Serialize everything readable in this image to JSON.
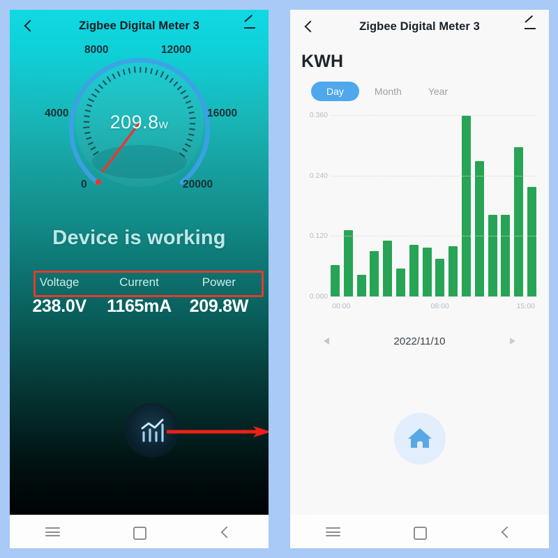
{
  "frame": {
    "background_color": "#a9c9f7"
  },
  "left_screen": {
    "header": {
      "back_icon": "back-chevron-icon",
      "title": "Zigbee Digital Meter 3",
      "edit_icon": "pencil-icon"
    },
    "gauge": {
      "value": "209.8",
      "unit": "W",
      "min": 0,
      "max": 20000,
      "ticks": [
        "0",
        "4000",
        "8000",
        "12000",
        "16000",
        "20000"
      ],
      "arc_color": "#3f9fe6",
      "needle_color": "#e8392c",
      "current_value": 209.8
    },
    "status_text": "Device is working",
    "metrics": {
      "headers": [
        "Voltage",
        "Current",
        "Power"
      ],
      "values": [
        "238.0V",
        "1165mA",
        "209.8W"
      ],
      "highlight_box_color": "#e8392c"
    },
    "chart_fab": {
      "icon": "bar-chart-icon"
    },
    "annotation_arrow": {
      "color": "#ee1f18",
      "direction": "right"
    },
    "navbar": {
      "items": [
        "recents-icon",
        "home-square-icon",
        "back-chevron-icon"
      ]
    }
  },
  "right_screen": {
    "header": {
      "back_icon": "back-chevron-icon",
      "title": "Zigbee Digital Meter 3",
      "edit_icon": "pencil-icon"
    },
    "page_title": "KWH",
    "tabs": [
      {
        "label": "Day",
        "active": true
      },
      {
        "label": "Month",
        "active": false
      },
      {
        "label": "Year",
        "active": false
      }
    ],
    "active_tab_color": "#4fa8ec",
    "date_nav": {
      "prev_icon": "triangle-left-icon",
      "date": "2022/11/10",
      "next_icon": "triangle-right-icon"
    },
    "home_button": {
      "icon": "home-icon",
      "color": "#5aa7e6",
      "background": "#e2eefc"
    },
    "navbar": {
      "items": [
        "recents-icon",
        "home-square-icon",
        "back-chevron-icon"
      ]
    }
  },
  "chart_data": {
    "type": "bar",
    "title": "KWH",
    "xlabel": "",
    "ylabel": "",
    "ylim": [
      0.0,
      0.36
    ],
    "yticks": [
      0.0,
      0.12,
      0.24,
      0.36
    ],
    "ytick_labels": [
      "0.000",
      "0.120",
      "0.240",
      "0.360"
    ],
    "grid": true,
    "bar_color": "#27a455",
    "categories": [
      "00:00",
      "01:00",
      "02:00",
      "03:00",
      "04:00",
      "05:00",
      "06:00",
      "07:00",
      "08:00",
      "09:00",
      "10:00",
      "11:00",
      "12:00",
      "13:00",
      "14:00",
      "15:00"
    ],
    "xtick_labels": [
      "00:00",
      "08:00",
      "15:00"
    ],
    "xtick_indices": [
      0,
      8,
      15
    ],
    "values": [
      0.063,
      0.131,
      0.043,
      0.09,
      0.111,
      0.055,
      0.103,
      0.097,
      0.075,
      0.1,
      0.358,
      0.268,
      0.162,
      0.162,
      0.296,
      0.218
    ]
  }
}
